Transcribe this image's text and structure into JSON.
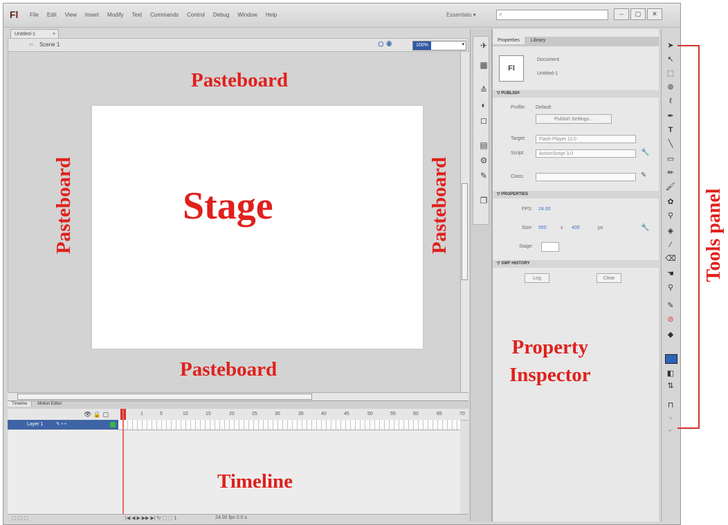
{
  "app": {
    "logo": "Fl",
    "menus": [
      "File",
      "Edit",
      "View",
      "Insert",
      "Modify",
      "Text",
      "Commands",
      "Control",
      "Debug",
      "Window",
      "Help"
    ],
    "workspace": "Essentials ▾",
    "search_placeholder": "",
    "window_buttons": [
      "–",
      "▢",
      "✕"
    ]
  },
  "document": {
    "tab_label": "Untitled-1",
    "tab_close": "×",
    "scene_label": "Scene 1",
    "back_arrow": "⇦",
    "zoom": "100%",
    "zoom_arrow": "▾"
  },
  "annotations": {
    "pasteboard_top": "Pasteboard",
    "pasteboard_left": "Pasteboard",
    "pasteboard_right": "Pasteboard",
    "pasteboard_bottom": "Pasteboard",
    "stage": "Stage",
    "timeline": "Timeline",
    "property_inspector": "Property\nInspector",
    "tools_panel": "Tools panel"
  },
  "timeline": {
    "tabs": [
      "Timeline",
      "Motion Editor"
    ],
    "layer_name": "Layer 1",
    "layer_controls": "✎ • •",
    "frame_numbers": [
      "1",
      "5",
      "10",
      "15",
      "20",
      "25",
      "30",
      "35",
      "40",
      "45",
      "50",
      "55",
      "60",
      "65",
      "70"
    ],
    "footer_controls": "|◀ ◀ ▶ ▶▶ ▶| ↻ ⬚ ⬚  1",
    "fps": "24.00 fps  0.0 s",
    "footer_left": "⬚ ⬚ ⬚",
    "header_icons": "👁 🔒 ▢"
  },
  "properties": {
    "tabs": [
      "Properties",
      "Library"
    ],
    "doc_icon": "Fl",
    "doc_kind": "Document",
    "doc_name": "Untitled-1",
    "publish_section": "▽ PUBLISH",
    "profile_label": "Profile:",
    "profile_value": "Default",
    "publish_settings": "Publish Settings...",
    "target_label": "Target:",
    "target_value": "Flash Player 11.0",
    "script_label": "Script:",
    "script_value": "ActionScript 3.0",
    "class_label": "Class:",
    "properties_section": "▽ PROPERTIES",
    "fps_label": "FPS:",
    "fps_value": "24.00",
    "size_label": "Size:",
    "size_w": "550",
    "size_x": "x",
    "size_h": "400",
    "size_unit": "px",
    "stage_label": "Stage:",
    "swf_section": "▽ SWF HISTORY",
    "log_button": "Log",
    "clear_button": "Clear"
  }
}
